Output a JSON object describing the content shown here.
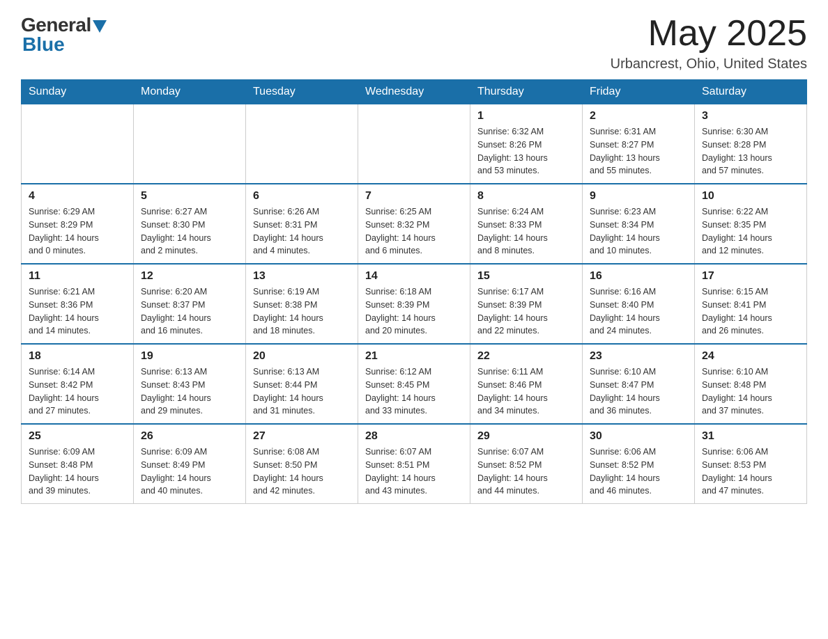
{
  "header": {
    "logo_general": "General",
    "logo_blue": "Blue",
    "month_year": "May 2025",
    "location": "Urbancrest, Ohio, United States"
  },
  "days_of_week": [
    "Sunday",
    "Monday",
    "Tuesday",
    "Wednesday",
    "Thursday",
    "Friday",
    "Saturday"
  ],
  "weeks": [
    [
      {
        "day": "",
        "info": ""
      },
      {
        "day": "",
        "info": ""
      },
      {
        "day": "",
        "info": ""
      },
      {
        "day": "",
        "info": ""
      },
      {
        "day": "1",
        "info": "Sunrise: 6:32 AM\nSunset: 8:26 PM\nDaylight: 13 hours\nand 53 minutes."
      },
      {
        "day": "2",
        "info": "Sunrise: 6:31 AM\nSunset: 8:27 PM\nDaylight: 13 hours\nand 55 minutes."
      },
      {
        "day": "3",
        "info": "Sunrise: 6:30 AM\nSunset: 8:28 PM\nDaylight: 13 hours\nand 57 minutes."
      }
    ],
    [
      {
        "day": "4",
        "info": "Sunrise: 6:29 AM\nSunset: 8:29 PM\nDaylight: 14 hours\nand 0 minutes."
      },
      {
        "day": "5",
        "info": "Sunrise: 6:27 AM\nSunset: 8:30 PM\nDaylight: 14 hours\nand 2 minutes."
      },
      {
        "day": "6",
        "info": "Sunrise: 6:26 AM\nSunset: 8:31 PM\nDaylight: 14 hours\nand 4 minutes."
      },
      {
        "day": "7",
        "info": "Sunrise: 6:25 AM\nSunset: 8:32 PM\nDaylight: 14 hours\nand 6 minutes."
      },
      {
        "day": "8",
        "info": "Sunrise: 6:24 AM\nSunset: 8:33 PM\nDaylight: 14 hours\nand 8 minutes."
      },
      {
        "day": "9",
        "info": "Sunrise: 6:23 AM\nSunset: 8:34 PM\nDaylight: 14 hours\nand 10 minutes."
      },
      {
        "day": "10",
        "info": "Sunrise: 6:22 AM\nSunset: 8:35 PM\nDaylight: 14 hours\nand 12 minutes."
      }
    ],
    [
      {
        "day": "11",
        "info": "Sunrise: 6:21 AM\nSunset: 8:36 PM\nDaylight: 14 hours\nand 14 minutes."
      },
      {
        "day": "12",
        "info": "Sunrise: 6:20 AM\nSunset: 8:37 PM\nDaylight: 14 hours\nand 16 minutes."
      },
      {
        "day": "13",
        "info": "Sunrise: 6:19 AM\nSunset: 8:38 PM\nDaylight: 14 hours\nand 18 minutes."
      },
      {
        "day": "14",
        "info": "Sunrise: 6:18 AM\nSunset: 8:39 PM\nDaylight: 14 hours\nand 20 minutes."
      },
      {
        "day": "15",
        "info": "Sunrise: 6:17 AM\nSunset: 8:39 PM\nDaylight: 14 hours\nand 22 minutes."
      },
      {
        "day": "16",
        "info": "Sunrise: 6:16 AM\nSunset: 8:40 PM\nDaylight: 14 hours\nand 24 minutes."
      },
      {
        "day": "17",
        "info": "Sunrise: 6:15 AM\nSunset: 8:41 PM\nDaylight: 14 hours\nand 26 minutes."
      }
    ],
    [
      {
        "day": "18",
        "info": "Sunrise: 6:14 AM\nSunset: 8:42 PM\nDaylight: 14 hours\nand 27 minutes."
      },
      {
        "day": "19",
        "info": "Sunrise: 6:13 AM\nSunset: 8:43 PM\nDaylight: 14 hours\nand 29 minutes."
      },
      {
        "day": "20",
        "info": "Sunrise: 6:13 AM\nSunset: 8:44 PM\nDaylight: 14 hours\nand 31 minutes."
      },
      {
        "day": "21",
        "info": "Sunrise: 6:12 AM\nSunset: 8:45 PM\nDaylight: 14 hours\nand 33 minutes."
      },
      {
        "day": "22",
        "info": "Sunrise: 6:11 AM\nSunset: 8:46 PM\nDaylight: 14 hours\nand 34 minutes."
      },
      {
        "day": "23",
        "info": "Sunrise: 6:10 AM\nSunset: 8:47 PM\nDaylight: 14 hours\nand 36 minutes."
      },
      {
        "day": "24",
        "info": "Sunrise: 6:10 AM\nSunset: 8:48 PM\nDaylight: 14 hours\nand 37 minutes."
      }
    ],
    [
      {
        "day": "25",
        "info": "Sunrise: 6:09 AM\nSunset: 8:48 PM\nDaylight: 14 hours\nand 39 minutes."
      },
      {
        "day": "26",
        "info": "Sunrise: 6:09 AM\nSunset: 8:49 PM\nDaylight: 14 hours\nand 40 minutes."
      },
      {
        "day": "27",
        "info": "Sunrise: 6:08 AM\nSunset: 8:50 PM\nDaylight: 14 hours\nand 42 minutes."
      },
      {
        "day": "28",
        "info": "Sunrise: 6:07 AM\nSunset: 8:51 PM\nDaylight: 14 hours\nand 43 minutes."
      },
      {
        "day": "29",
        "info": "Sunrise: 6:07 AM\nSunset: 8:52 PM\nDaylight: 14 hours\nand 44 minutes."
      },
      {
        "day": "30",
        "info": "Sunrise: 6:06 AM\nSunset: 8:52 PM\nDaylight: 14 hours\nand 46 minutes."
      },
      {
        "day": "31",
        "info": "Sunrise: 6:06 AM\nSunset: 8:53 PM\nDaylight: 14 hours\nand 47 minutes."
      }
    ]
  ]
}
